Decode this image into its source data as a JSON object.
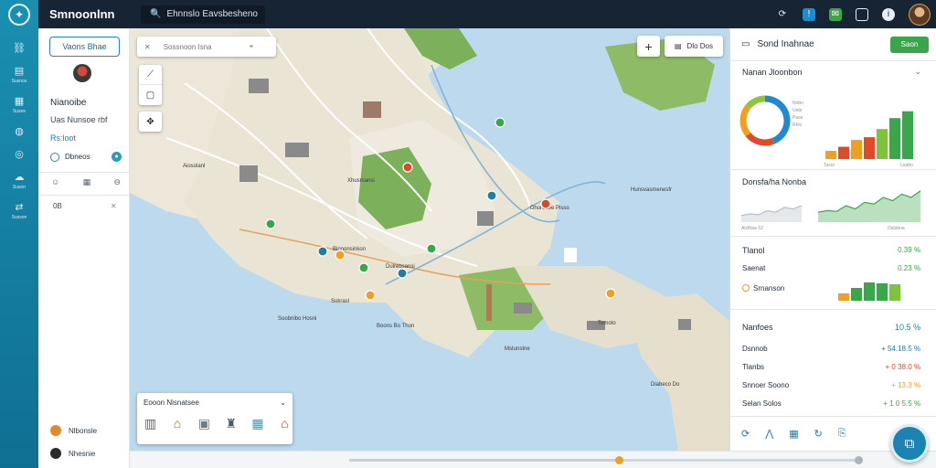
{
  "app": {
    "title": "Smnoonlnn"
  },
  "topbar": {
    "search_value": "Ehnnslo Eavsbeshenoo",
    "icons": [
      "refresh-icon",
      "notification-icon",
      "message-icon",
      "window-icon",
      "info-icon"
    ]
  },
  "rail": {
    "items": [
      {
        "icon": "link-icon",
        "label": ""
      },
      {
        "icon": "document-icon",
        "label": "Susnos"
      },
      {
        "icon": "layers-icon",
        "label": "Susee"
      },
      {
        "icon": "globe-icon",
        "label": ""
      },
      {
        "icon": "target-icon",
        "label": ""
      },
      {
        "icon": "cloud-icon",
        "label": "Suson"
      },
      {
        "icon": "share-icon",
        "label": "Susson"
      }
    ]
  },
  "sidebar": {
    "primary_button": "Vaons Bhae",
    "profile_name": "Nianoibe",
    "profile_sub": "Uas Nunsoe rbf",
    "link": "Rs:loot",
    "status_label": "Dbneos",
    "count": "0B",
    "users": [
      {
        "name": "Nlbonsle",
        "color": "#e08a2a"
      },
      {
        "name": "Nhesnie",
        "color": "#2b2b2b"
      }
    ]
  },
  "map": {
    "search_placeholder": "Sossnoon Isna",
    "layer_label": "Dlo Dos",
    "tools": [
      "draw-icon",
      "select-icon",
      "measure-icon"
    ],
    "extra_tool": "navigate-icon",
    "labels": [
      {
        "text": "Aiosolanl",
        "pos": [
          58,
          152
        ]
      },
      {
        "text": "Xhusmansi",
        "pos": [
          238,
          168
        ]
      },
      {
        "text": "Binnonsinkon",
        "pos": [
          222,
          243
        ]
      },
      {
        "text": "Dulrebsansi",
        "pos": [
          280,
          262
        ]
      },
      {
        "text": "Sokrasl",
        "pos": [
          220,
          300
        ]
      },
      {
        "text": "Soobnibo Hosni",
        "pos": [
          162,
          319
        ]
      },
      {
        "text": "Boons Bo Thon",
        "pos": [
          270,
          327
        ]
      },
      {
        "text": "Tomoto",
        "pos": [
          512,
          324
        ]
      },
      {
        "text": "Diabeco Do",
        "pos": [
          570,
          391
        ]
      },
      {
        "text": "Hunsvasmenesfr",
        "pos": [
          548,
          178
        ]
      },
      {
        "text": "Dhorebee Pisso",
        "pos": [
          438,
          198
        ]
      },
      {
        "text": "Mstunstne",
        "pos": [
          410,
          352
        ]
      }
    ]
  },
  "legend": {
    "title": "Eooon Nisnatsee",
    "items": [
      "building-icon",
      "factory-icon",
      "warehouse-icon",
      "tower-icon",
      "depot-icon",
      "market-icon"
    ]
  },
  "panel": {
    "title": "Sond Inahnae",
    "action_button": "Saon",
    "footer_icons": [
      "analytics-icon",
      "trend-icon",
      "grid-icon",
      "sync-icon",
      "export-icon"
    ]
  },
  "fab": {
    "icon": "open-icon"
  },
  "colors": {
    "accent": "#1b82b1",
    "positive": "#3aa64a",
    "warning": "#f0a020",
    "negative": "#d94a2a"
  },
  "chart_data": [
    {
      "type": "pie",
      "title": "Nanan Jloonbon",
      "values": [
        44,
        20,
        22,
        14
      ],
      "colors": [
        "#1f8ad2",
        "#e04a2a",
        "#f0a020",
        "#8cc63f"
      ],
      "labels": [
        "Nnbn",
        "Uebr",
        "Pase",
        "Rhlo"
      ]
    },
    {
      "type": "bar",
      "categories": [
        "Tasor",
        "",
        "",
        "",
        "",
        "",
        "Leabo"
      ],
      "values": [
        12,
        18,
        28,
        32,
        44,
        60,
        70
      ],
      "colors": [
        "#f0a020",
        "#e04a2a",
        "#f0a020",
        "#e04a2a",
        "#7cc43a",
        "#3aa64a",
        "#3aa64a"
      ],
      "ylim": [
        0,
        75
      ]
    },
    {
      "type": "area",
      "title": "Donsfa/ha Nonba",
      "series": [
        {
          "values": [
            8,
            10,
            9,
            14,
            12,
            18,
            16,
            20
          ],
          "color": "#b7c0c8"
        },
        {
          "values": [
            12,
            14,
            13,
            20,
            16,
            24,
            22,
            30,
            26,
            34,
            30,
            38
          ],
          "color": "#3aa64a"
        }
      ],
      "x_labels": [
        "Alsfilisa 52",
        "Ostsbna"
      ],
      "ylim": [
        0,
        40
      ]
    },
    {
      "type": "table",
      "title": "Tlanol",
      "rows": [
        {
          "label": "",
          "value": "0.39 %",
          "color": "#3aa64a"
        },
        {
          "label": "Saenat",
          "value": "0.23 %",
          "color": "#3aa64a"
        },
        {
          "label": "Srnanson",
          "value": "",
          "color": "#f0a020"
        }
      ],
      "bars": {
        "values": [
          8,
          14,
          20,
          19,
          18
        ],
        "colors": [
          "#f0a020",
          "#3aa64a",
          "#3aa64a",
          "#3aa64a",
          "#7cc43a"
        ],
        "ylim": [
          0,
          22
        ]
      }
    },
    {
      "type": "table",
      "title": "Nanfoes",
      "headline_value": "10.5 %",
      "rows": [
        {
          "label": "Dsnnob",
          "value": "+ 54.18.5 %",
          "color": "#1f7ea6"
        },
        {
          "label": "Tlanbs",
          "value": "+ 0 38.0 %",
          "color": "#e04a2a"
        },
        {
          "label": "Snnoer Soono",
          "value": "+ 13.3 %",
          "color": "#f0a020"
        },
        {
          "label": "Selan Solos",
          "value": "+ 1 0 5.5 %",
          "color": "#3aa64a"
        }
      ]
    }
  ]
}
